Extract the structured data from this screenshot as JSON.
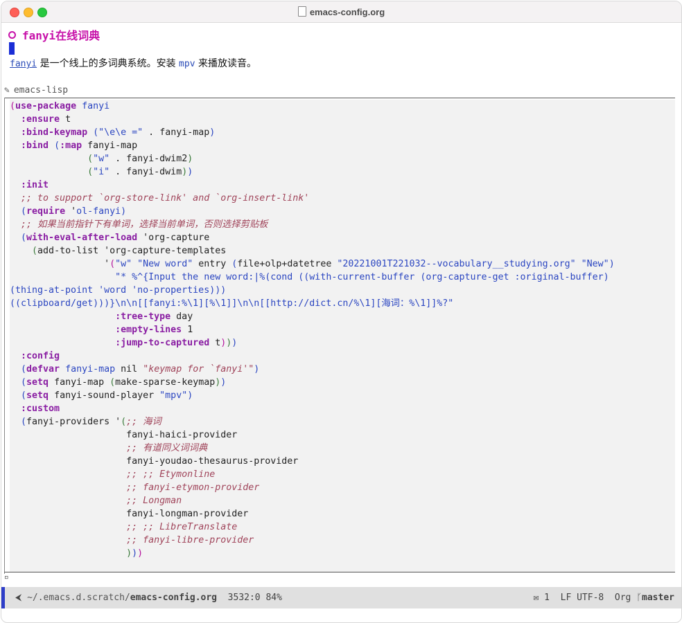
{
  "window": {
    "title": "emacs-config.org"
  },
  "heading": {
    "text": "fanyi在线词典"
  },
  "paragraph": {
    "link": "fanyi",
    "text1": " 是一个线上的多词典系统。安装 ",
    "code": "mpv",
    "text2": " 来播放读音。"
  },
  "src_block": {
    "language": "emacs-lisp",
    "lines": [
      [
        [
          "pp",
          "("
        ],
        [
          "kw",
          "use-package"
        ],
        [
          "t",
          " "
        ],
        [
          "fn",
          "fanyi"
        ]
      ],
      [
        [
          "t",
          "  "
        ],
        [
          "kw",
          ":ensure"
        ],
        [
          "t",
          " t"
        ]
      ],
      [
        [
          "t",
          "  "
        ],
        [
          "kw",
          ":bind-keymap"
        ],
        [
          "t",
          " "
        ],
        [
          "pb",
          "("
        ],
        [
          "st",
          "\"\\e\\e =\""
        ],
        [
          "t",
          " . fanyi-map"
        ],
        [
          "pb",
          ")"
        ]
      ],
      [
        [
          "t",
          "  "
        ],
        [
          "kw",
          ":bind"
        ],
        [
          "t",
          " "
        ],
        [
          "pb",
          "("
        ],
        [
          "kw",
          ":map"
        ],
        [
          "t",
          " fanyi-map"
        ]
      ],
      [
        [
          "t",
          "              "
        ],
        [
          "pt",
          "("
        ],
        [
          "st",
          "\"w\""
        ],
        [
          "t",
          " . fanyi-dwim2"
        ],
        [
          "pt",
          ")"
        ]
      ],
      [
        [
          "t",
          "              "
        ],
        [
          "pt",
          "("
        ],
        [
          "st",
          "\"i\""
        ],
        [
          "t",
          " . fanyi-dwim"
        ],
        [
          "pt",
          ")"
        ],
        [
          "pb",
          ")"
        ]
      ],
      [
        [
          "t",
          "  "
        ],
        [
          "kw",
          ":init"
        ]
      ],
      [
        [
          "t",
          "  "
        ],
        [
          "cm",
          ";; to support `org-store-link' and `org-insert-link'"
        ]
      ],
      [
        [
          "t",
          "  "
        ],
        [
          "pb",
          "("
        ],
        [
          "kw",
          "require"
        ],
        [
          "t",
          " '"
        ],
        [
          "fn",
          "ol-fanyi"
        ],
        [
          "pb",
          ")"
        ]
      ],
      [
        [
          "t",
          "  "
        ],
        [
          "cm",
          ";; 如果当前指针下有单词，选择当前单词，否则选择剪贴板"
        ]
      ],
      [
        [
          "t",
          "  "
        ],
        [
          "pb",
          "("
        ],
        [
          "kw",
          "with-eval-after-load"
        ],
        [
          "t",
          " 'org-capture"
        ]
      ],
      [
        [
          "t",
          "    "
        ],
        [
          "pt",
          "("
        ],
        [
          "t",
          "add-to-list 'org-capture-templates"
        ]
      ],
      [
        [
          "t",
          "                 '"
        ],
        [
          "pp",
          "("
        ],
        [
          "st",
          "\"w\""
        ],
        [
          "t",
          " "
        ],
        [
          "st",
          "\"New word\""
        ],
        [
          "t",
          " entry "
        ],
        [
          "pb",
          "("
        ],
        [
          "t",
          "file+olp+datetree "
        ],
        [
          "st",
          "\"20221001T221032--vocabulary__studying.org\""
        ],
        [
          "t",
          " "
        ],
        [
          "st",
          "\"New\""
        ],
        [
          "pb",
          ")"
        ]
      ],
      [
        [
          "t",
          "                   "
        ],
        [
          "st",
          "\"* %^{Input the new word:|%(cond ((with-current-buffer (org-capture-get :original-buffer)"
        ]
      ],
      [
        [
          "st",
          "(thing-at-point 'word 'no-properties)))"
        ]
      ],
      [
        [
          "st",
          "((clipboard/get)))}\\n\\n[[fanyi:%\\1][%\\1]]\\n\\n[[http://dict.cn/%\\1][海词：%\\1]]%?\""
        ]
      ],
      [
        [
          "t",
          "                   "
        ],
        [
          "kw",
          ":tree-type"
        ],
        [
          "t",
          " day"
        ]
      ],
      [
        [
          "t",
          "                   "
        ],
        [
          "kw",
          ":empty-lines"
        ],
        [
          "t",
          " 1"
        ]
      ],
      [
        [
          "t",
          "                   "
        ],
        [
          "kw",
          ":jump-to-captured"
        ],
        [
          "t",
          " t"
        ],
        [
          "pp",
          ")"
        ],
        [
          "pt",
          ")"
        ],
        [
          "pb",
          ")"
        ]
      ],
      [
        [
          "t",
          "  "
        ],
        [
          "kw",
          ":config"
        ]
      ],
      [
        [
          "t",
          "  "
        ],
        [
          "pb",
          "("
        ],
        [
          "kw",
          "defvar"
        ],
        [
          "t",
          " "
        ],
        [
          "fn",
          "fanyi-map"
        ],
        [
          "t",
          " nil "
        ],
        [
          "cm",
          "\"keymap for `fanyi'\""
        ],
        [
          "pb",
          ")"
        ]
      ],
      [
        [
          "t",
          "  "
        ],
        [
          "pb",
          "("
        ],
        [
          "kw",
          "setq"
        ],
        [
          "t",
          " fanyi-map "
        ],
        [
          "pt",
          "("
        ],
        [
          "t",
          "make-sparse-keymap"
        ],
        [
          "pt",
          ")"
        ],
        [
          "pb",
          ")"
        ]
      ],
      [
        [
          "t",
          "  "
        ],
        [
          "pb",
          "("
        ],
        [
          "kw",
          "setq"
        ],
        [
          "t",
          " fanyi-sound-player "
        ],
        [
          "st",
          "\"mpv\""
        ],
        [
          "pb",
          ")"
        ]
      ],
      [
        [
          "t",
          "  "
        ],
        [
          "kw",
          ":custom"
        ]
      ],
      [
        [
          "t",
          "  "
        ],
        [
          "pb",
          "("
        ],
        [
          "t",
          "fanyi-providers '"
        ],
        [
          "pt",
          "("
        ],
        [
          "cm",
          ";; 海词"
        ]
      ],
      [
        [
          "t",
          "                     fanyi-haici-provider"
        ]
      ],
      [
        [
          "t",
          "                     "
        ],
        [
          "cm",
          ";; 有道同义词词典"
        ]
      ],
      [
        [
          "t",
          "                     fanyi-youdao-thesaurus-provider"
        ]
      ],
      [
        [
          "t",
          "                     "
        ],
        [
          "cm",
          ";; ;; Etymonline"
        ]
      ],
      [
        [
          "t",
          "                     "
        ],
        [
          "cm",
          ";; fanyi-etymon-provider"
        ]
      ],
      [
        [
          "t",
          "                     "
        ],
        [
          "cm",
          ";; Longman"
        ]
      ],
      [
        [
          "t",
          "                     fanyi-longman-provider"
        ]
      ],
      [
        [
          "t",
          "                     "
        ],
        [
          "cm",
          ";; ;; LibreTranslate"
        ]
      ],
      [
        [
          "t",
          "                     "
        ],
        [
          "cm",
          ";; fanyi-libre-provider"
        ]
      ],
      [
        [
          "t",
          "                     "
        ],
        [
          "pt",
          ")"
        ],
        [
          "pb",
          ")"
        ],
        [
          "pp",
          ")"
        ]
      ]
    ]
  },
  "modeline": {
    "dir": "~/.emacs.d.scratch/",
    "file": "emacs-config.org",
    "position": "3532:0 84%",
    "mail_count": "1",
    "encoding": "LF UTF-8",
    "mode": "Org",
    "branch": "master"
  },
  "colors": {
    "accent": "#2d3dc8",
    "heading": "#c711a9",
    "keyword": "#8a1ea3",
    "comment": "#a0445a"
  }
}
